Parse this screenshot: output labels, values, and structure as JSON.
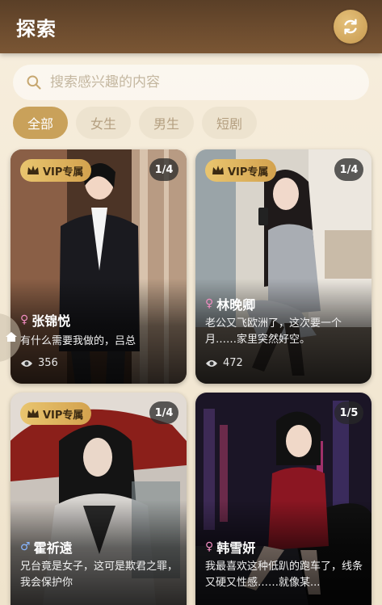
{
  "header": {
    "title": "探索",
    "refresh_icon": "refresh-icon"
  },
  "search": {
    "placeholder": "搜索感兴趣的内容",
    "icon": "search-icon"
  },
  "tabs": [
    {
      "label": "全部",
      "active": true
    },
    {
      "label": "女生",
      "active": false
    },
    {
      "label": "男生",
      "active": false
    },
    {
      "label": "短剧",
      "active": false
    }
  ],
  "cards": [
    {
      "vip": "VIP专属",
      "counter": "1/4",
      "gender": "♀",
      "name": "张锦悦",
      "desc": "有什么需要我做的，吕总",
      "views": "356"
    },
    {
      "vip": "VIP专属",
      "counter": "1/4",
      "gender": "♀",
      "name": "林晚卿",
      "desc": "老公又飞欧洲了，这次要一个月……家里突然好空。",
      "views": "472"
    },
    {
      "vip": "VIP专属",
      "counter": "1/4",
      "gender": "♂",
      "name": "霍祈遠",
      "desc": "兄台竟是女子，这可是欺君之罪，我会保护你"
    },
    {
      "vip": "",
      "counter": "1/5",
      "gender": "♀",
      "name": "韩雪妍",
      "desc": "我最喜欢这种低趴的跑车了，线条又硬又性感……就像某..."
    }
  ],
  "colors": {
    "accent": "#c9a15a",
    "topbar": "#6e4d2f",
    "female": "#f08cc0",
    "male": "#88b6ff"
  }
}
